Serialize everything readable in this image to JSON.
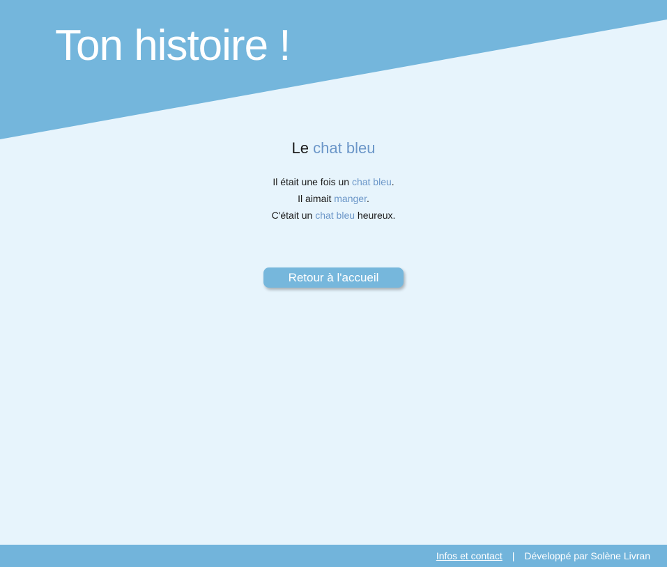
{
  "header": {
    "title": "Ton histoire !",
    "band_color": "#74b6dc"
  },
  "story": {
    "title_prefix": "Le ",
    "title_highlight": "chat bleu",
    "lines": [
      {
        "before": "Il était une fois un ",
        "highlight": "chat bleu",
        "after": "."
      },
      {
        "before": "Il aimait ",
        "highlight": "manger",
        "after": "."
      },
      {
        "before": "C'était un ",
        "highlight": "chat bleu",
        "after": " heureux."
      }
    ],
    "highlight_color": "#6b96c8"
  },
  "actions": {
    "home_label": "Retour à l'accueil"
  },
  "footer": {
    "contact_link": "Infos et contact",
    "separator": "|",
    "credit": "Développé par Solène Livran",
    "bg_color": "#72b4db"
  },
  "theme": {
    "page_bg": "#e7f4fc",
    "button_bg": "#76b7dc"
  }
}
